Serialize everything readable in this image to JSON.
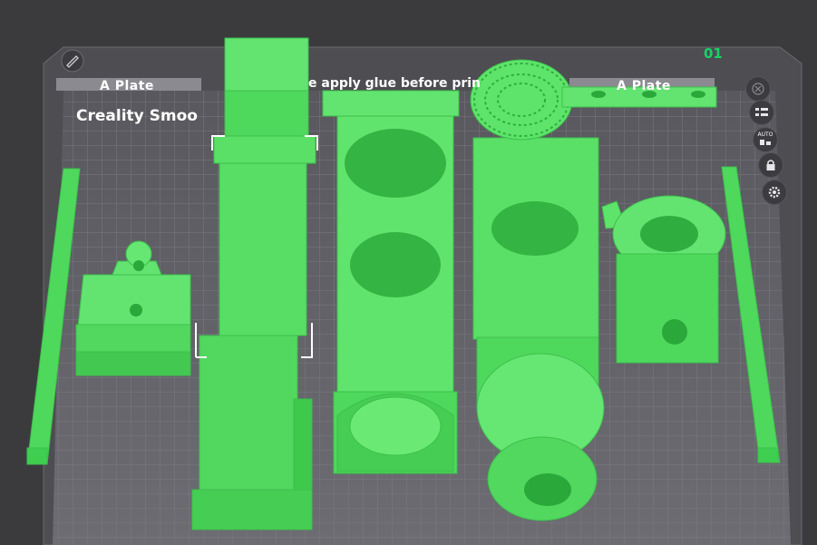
{
  "plate": {
    "index_label": "01",
    "left_tab_label": "A Plate",
    "right_tab_label": "A Plate",
    "notice_text": "e apply glue before prin",
    "printer_label": "Creality Smoo",
    "accent_color": "#18d266",
    "model_color": "#5ee46a"
  },
  "sidebar": {
    "buttons": [
      {
        "name": "close-icon"
      },
      {
        "name": "list-icon"
      },
      {
        "name": "auto-arrange-icon",
        "label": "AUTO"
      },
      {
        "name": "lock-icon"
      },
      {
        "name": "gear-icon"
      }
    ]
  }
}
